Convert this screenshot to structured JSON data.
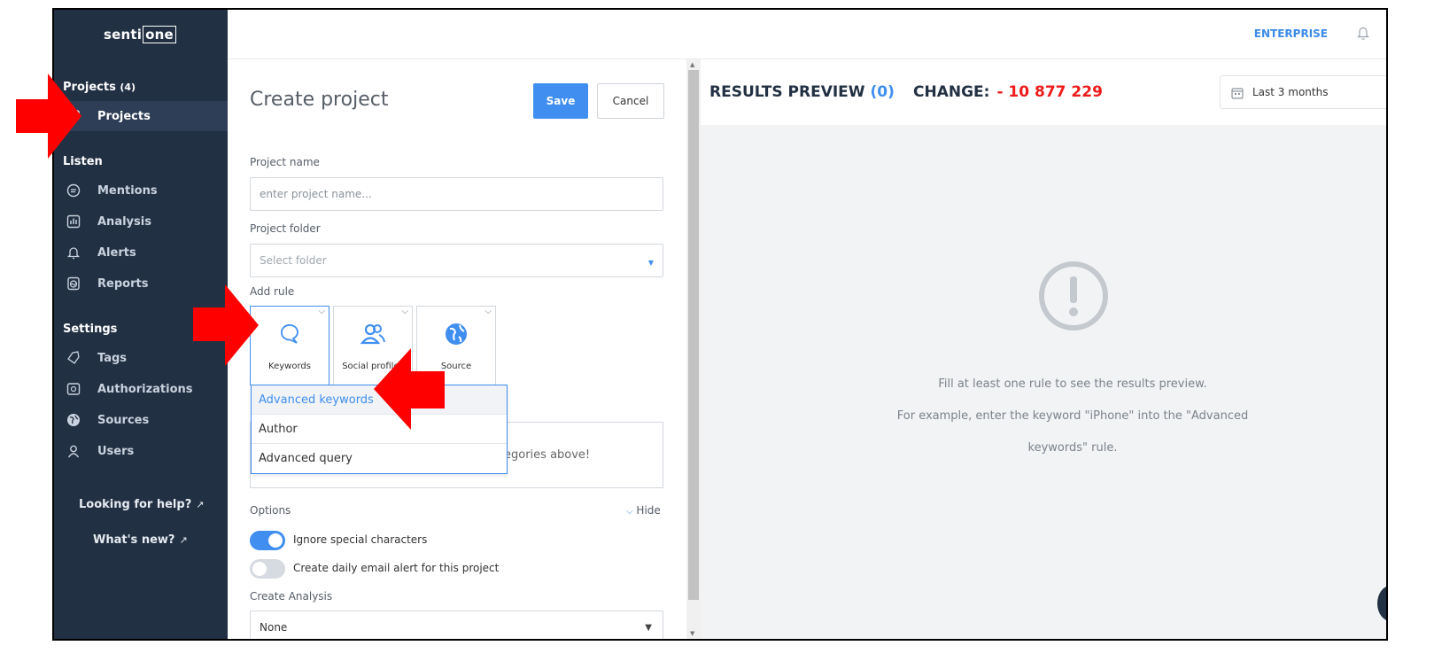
{
  "sidebar": {
    "logo_prefix": "senti",
    "logo_box": "one",
    "projects_header": "Projects",
    "projects_count": "(4)",
    "projects_item": "Projects",
    "listen_header": "Listen",
    "listen_items": [
      "Mentions",
      "Analysis",
      "Alerts",
      "Reports"
    ],
    "settings_header": "Settings",
    "settings_items": [
      "Tags",
      "Authorizations",
      "Sources",
      "Users"
    ],
    "help_label": "Looking for help?",
    "whats_new_label": "What's new?"
  },
  "topbar": {
    "plan_label": "ENTERPRISE"
  },
  "form": {
    "title": "Create project",
    "save_label": "Save",
    "cancel_label": "Cancel",
    "project_name_label": "Project name",
    "project_name_placeholder": "enter project name...",
    "project_folder_label": "Project folder",
    "project_folder_placeholder": "Select folder",
    "add_rule_label": "Add rule",
    "rule_cards": [
      "Keywords",
      "Social profiles",
      "Source"
    ],
    "dropdown_items": [
      "Advanced keywords",
      "Author",
      "Advanced query"
    ],
    "rules_hint": "egories above!",
    "options_label": "Options",
    "hide_label": "Hide",
    "toggle_ignore_label": "Ignore special characters",
    "toggle_ignore_on": true,
    "toggle_alert_label": "Create daily email alert for this project",
    "toggle_alert_on": false,
    "create_analysis_label": "Create Analysis",
    "create_analysis_value": "None"
  },
  "preview": {
    "title": "RESULTS PREVIEW",
    "count": "(0)",
    "change_label": "CHANGE:",
    "change_value": "- 10 877 229",
    "date_range": "Last 3 months",
    "empty_line1": "Fill at least one rule to see the results preview.",
    "empty_line2": "For example, enter the keyword \"iPhone\" into the \"Advanced",
    "empty_line3": "keywords\" rule."
  },
  "colors": {
    "sidebar_bg": "#223043",
    "accent": "#3f8ef0",
    "change_red": "#ee1b1b",
    "annotation_arrow": "#ff0000"
  }
}
